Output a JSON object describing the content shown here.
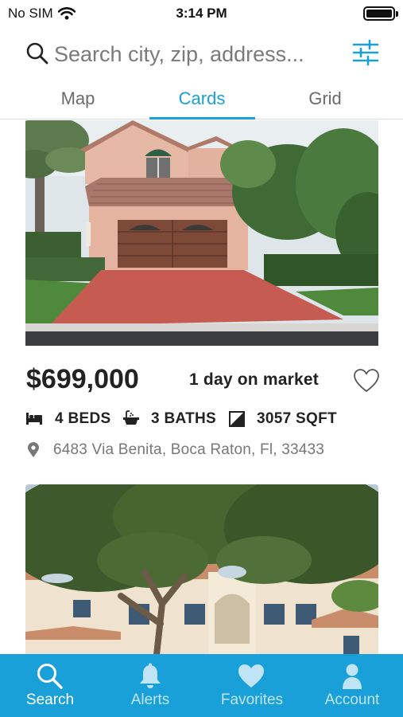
{
  "status_bar": {
    "carrier": "No SIM",
    "time": "3:14 PM"
  },
  "search": {
    "placeholder": "Search city, zip, address..."
  },
  "tabs": [
    {
      "label": "Map",
      "active": false
    },
    {
      "label": "Cards",
      "active": true
    },
    {
      "label": "Grid",
      "active": false
    }
  ],
  "listings": [
    {
      "price": "$699,000",
      "days_on_market": "1 day on market",
      "beds": "4 BEDS",
      "baths": "3 BATHS",
      "sqft": "3057 SQFT",
      "address": "6483 Via Benita, Boca Raton, Fl, 33433",
      "favorited": false
    },
    {
      "photo_only": true
    }
  ],
  "bottom_nav": [
    {
      "label": "Search",
      "icon": "search-icon",
      "active": true
    },
    {
      "label": "Alerts",
      "icon": "bell-icon",
      "active": false
    },
    {
      "label": "Favorites",
      "icon": "heart-icon",
      "active": false
    },
    {
      "label": "Account",
      "icon": "person-icon",
      "active": false
    }
  ],
  "colors": {
    "accent": "#1aa0d8",
    "text": "#222222",
    "muted": "#777777"
  }
}
